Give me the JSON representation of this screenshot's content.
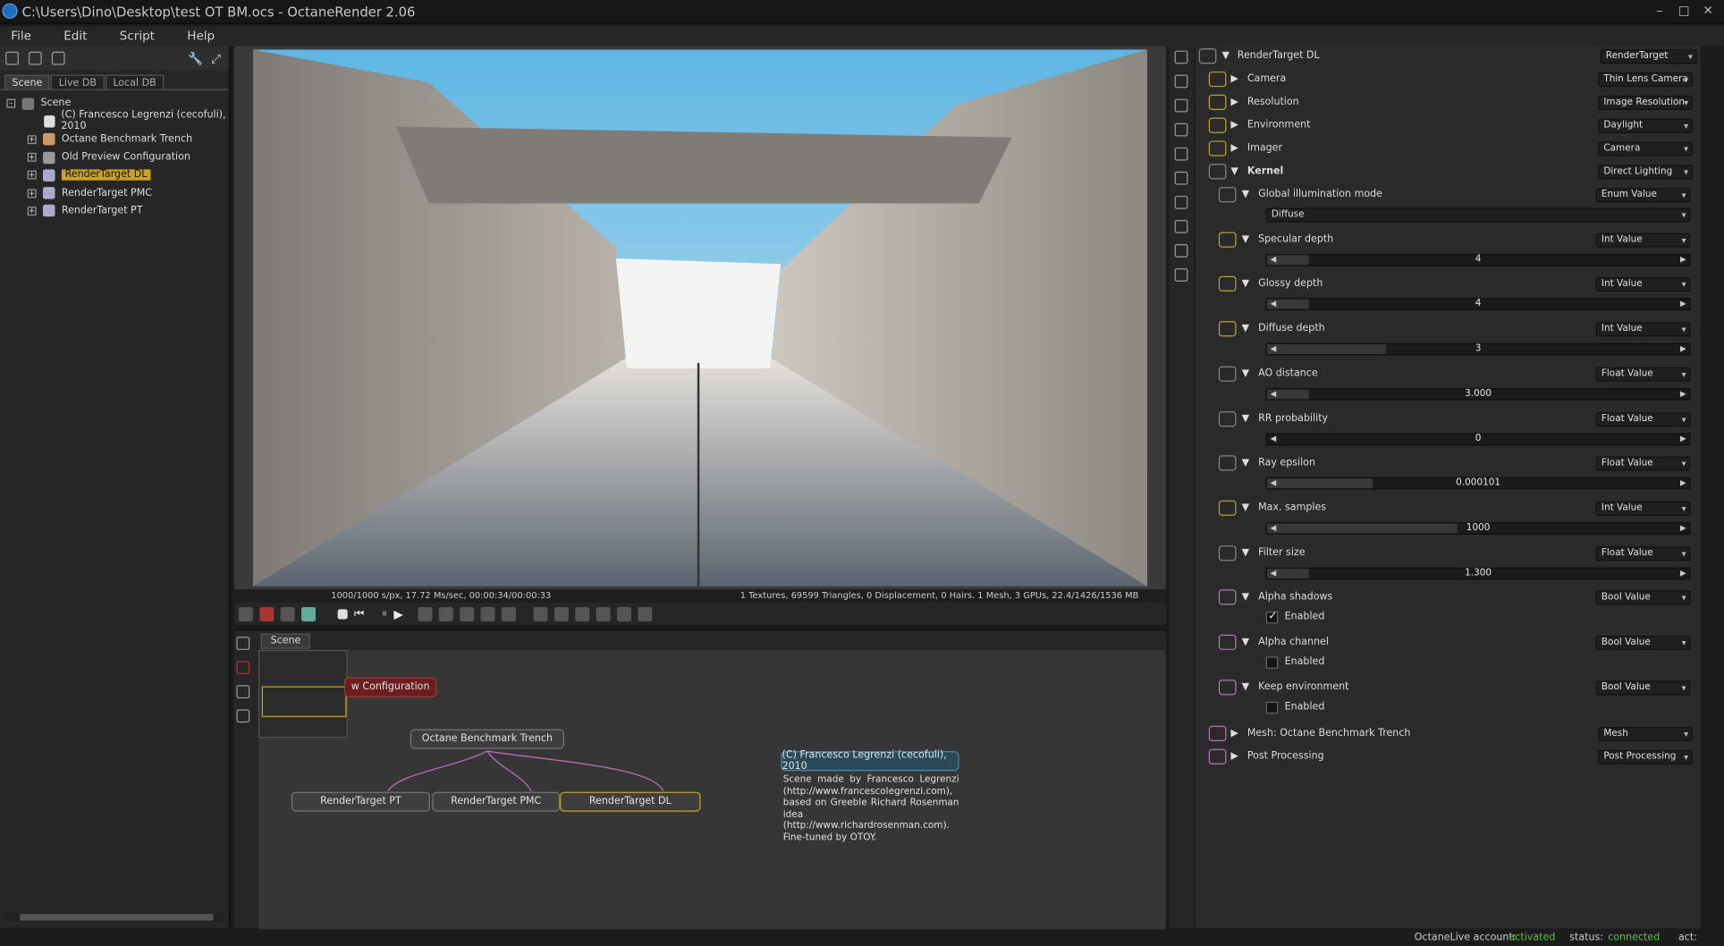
{
  "window": {
    "title": "C:\\Users\\Dino\\Desktop\\test OT BM.ocs - OctaneRender 2.06"
  },
  "menu": [
    "File",
    "Edit",
    "Script",
    "Help"
  ],
  "scene_tabs": [
    "Scene",
    "Live DB",
    "Local DB"
  ],
  "tree": {
    "root": "Scene",
    "items": [
      "(C) Francesco Legrenzi (cecofuli), 2010",
      "Octane Benchmark Trench",
      "Old Preview Configuration",
      "RenderTarget DL",
      "RenderTarget PMC",
      "RenderTarget PT"
    ]
  },
  "render_status": {
    "left": "1000/1000 s/px, 17.72 Ms/sec, 00:00:34/00:00:33",
    "right": "1 Textures, 69599 Triangles, 0 Displacement, 0 Hairs. 1 Mesh, 3 GPUs, 22.4/1426/1536 MB"
  },
  "node_graph": {
    "tab": "Scene",
    "nodes": {
      "preview": "w Configuration",
      "trench": "Octane Benchmark Trench",
      "pt": "RenderTarget PT",
      "pmc": "RenderTarget PMC",
      "dl": "RenderTarget DL",
      "comment": "(C) Francesco Legrenzi (cecofuli), 2010"
    },
    "comment_text": "Scene made by Francesco Legrenzi (http://www.francescolegrenzi.com), based on Greeble Richard Rosenman idea (http://www.richardrosenman.com). Fine-tuned by OTOY."
  },
  "inspector": {
    "header": {
      "label": "RenderTarget DL",
      "type": "RenderTarget"
    },
    "sections": [
      {
        "label": "Camera",
        "value": "Thin Lens Camera"
      },
      {
        "label": "Resolution",
        "value": "Image Resolution"
      },
      {
        "label": "Environment",
        "value": "Daylight"
      },
      {
        "label": "Imager",
        "value": "Camera"
      },
      {
        "label": "Kernel",
        "value": "Direct Lighting"
      }
    ],
    "params": [
      {
        "label": "Global illumination mode",
        "type": "Enum Value",
        "value": "Diffuse"
      },
      {
        "label": "Specular depth",
        "type": "Int Value",
        "value": "4",
        "fill": 0.1
      },
      {
        "label": "Glossy depth",
        "type": "Int Value",
        "value": "4",
        "fill": 0.1
      },
      {
        "label": "Diffuse depth",
        "type": "Int Value",
        "value": "3",
        "fill": 0.28
      },
      {
        "label": "AO distance",
        "type": "Float Value",
        "value": "3.000",
        "fill": 0.1
      },
      {
        "label": "RR probability",
        "type": "Float Value",
        "value": "0",
        "fill": 0
      },
      {
        "label": "Ray epsilon",
        "type": "Float Value",
        "value": "0.000101",
        "fill": 0.25
      },
      {
        "label": "Max. samples",
        "type": "Int Value",
        "value": "1000",
        "fill": 0.45
      },
      {
        "label": "Filter size",
        "type": "Float Value",
        "value": "1.300",
        "fill": 0.1
      },
      {
        "label": "Alpha shadows",
        "type": "Bool Value",
        "check": "Enabled",
        "checked": true
      },
      {
        "label": "Alpha channel",
        "type": "Bool Value",
        "check": "Enabled",
        "checked": false
      },
      {
        "label": "Keep environment",
        "type": "Bool Value",
        "check": "Enabled",
        "checked": false
      }
    ],
    "footer": [
      {
        "label": "Mesh:  Octane Benchmark Trench",
        "value": "Mesh"
      },
      {
        "label": "Post Processing",
        "value": "Post Processing"
      }
    ]
  },
  "statusbar": {
    "account_label": "OctaneLive account:",
    "account_value": "activated",
    "status_label": "status:",
    "status_value": "connected",
    "act": "act:"
  }
}
